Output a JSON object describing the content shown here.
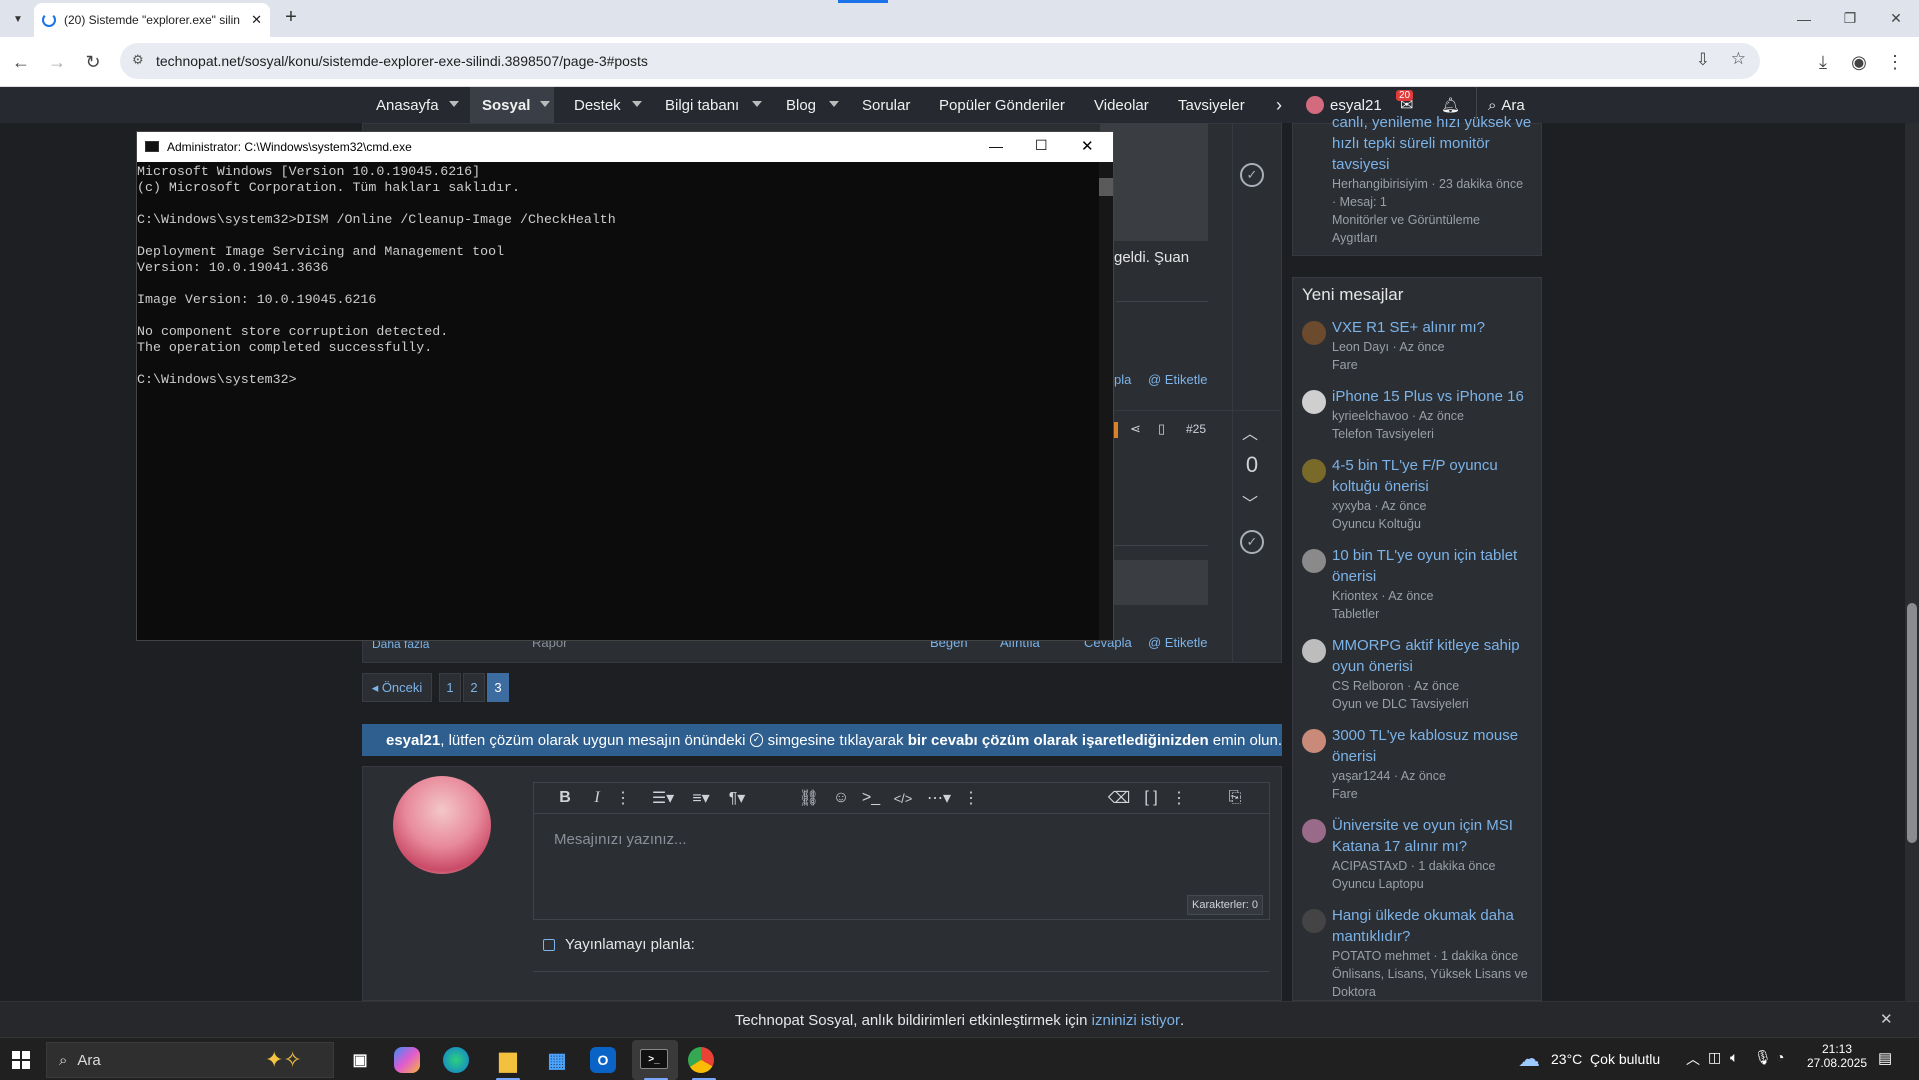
{
  "browser": {
    "tab_title": "(20) Sistemde \"explorer.exe\" silin",
    "url": "technopat.net/sosyal/konu/sistemde-explorer-exe-silindi.3898507/page-3#posts"
  },
  "site_nav": {
    "items": [
      "Anasayfa",
      "Sosyal",
      "Destek",
      "Bilgi tabanı",
      "Blog",
      "Sorular",
      "Popüler Gönderiler",
      "Videolar",
      "Tavsiyeler"
    ],
    "username": "esyal21",
    "inbox_badge": "20",
    "search_label": "Ara"
  },
  "sidebar": {
    "top_item": {
      "title_lines": [
        "canlı, yenileme hızı yüksek ve",
        "hızlı tepki süreli monitör",
        "tavsiyesi"
      ],
      "meta": "Herhangibirisiyim · 23 dakika önce",
      "meta2": "· Mesaj: 1",
      "category_lines": [
        "Monitörler ve Görüntüleme",
        "Aygıtları"
      ]
    },
    "heading": "Yeni mesajlar",
    "items": [
      {
        "title_lines": [
          "VXE R1 SE+ alınır mı?"
        ],
        "meta": "Leon Dayı · Az önce",
        "category_lines": [
          "Fare"
        ]
      },
      {
        "title_lines": [
          "iPhone 15 Plus vs iPhone 16"
        ],
        "meta": "kyrieelchavoo · Az önce",
        "category_lines": [
          "Telefon Tavsiyeleri"
        ]
      },
      {
        "title_lines": [
          "4-5 bin TL'ye F/P oyuncu",
          "koltuğu önerisi"
        ],
        "meta": "xyxyba · Az önce",
        "category_lines": [
          "Oyuncu Koltuğu"
        ]
      },
      {
        "title_lines": [
          "10 bin TL'ye oyun için tablet",
          "önerisi"
        ],
        "meta": "Kriontex · Az önce",
        "category_lines": [
          "Tabletler"
        ]
      },
      {
        "title_lines": [
          "MMORPG aktif kitleye sahip",
          "oyun önerisi"
        ],
        "meta": "CS Relboron · Az önce",
        "category_lines": [
          "Oyun ve DLC Tavsiyeleri"
        ]
      },
      {
        "title_lines": [
          "3000 TL'ye kablosuz mouse",
          "önerisi"
        ],
        "meta": "yaşar1244 · Az önce",
        "category_lines": [
          "Fare"
        ]
      },
      {
        "title_lines": [
          "Üniversite ve oyun için MSI",
          "Katana 17 alınır mı?"
        ],
        "meta": "ACIPASTAxD · 1 dakika önce",
        "category_lines": [
          "Oyuncu Laptopu"
        ]
      },
      {
        "title_lines": [
          "Hangi ülkede okumak daha",
          "mantıklıdır?"
        ],
        "meta": "POTATO mehmet · 1 dakika önce",
        "category_lines": [
          "Önlisans, Lisans, Yüksek Lisans ve",
          "Doktora"
        ]
      }
    ]
  },
  "post": {
    "partial_text": "geldi. Şuan",
    "reply_label": "pla",
    "tag_label": "@ Etiketle",
    "post_number": "#25",
    "vote_count": "0",
    "more_label": "Daha fazla",
    "report_label": "Rapor",
    "like_label": "Beğen",
    "quote_label": "Alıntıla",
    "reply_full": "Cevapla",
    "tag_label2": "@ Etiketle"
  },
  "pagination": {
    "prev": "◂ Önceki",
    "pages": [
      "1",
      "2",
      "3"
    ],
    "current": "3"
  },
  "notice": {
    "user": "esyal21",
    "text1": ", lütfen çözüm olarak uygun mesajın önündeki ",
    "text2": " simgesine tıklayarak ",
    "bold": "bir cevabı çözüm olarak işaretlediğinizden",
    "text3": " emin olun."
  },
  "editor": {
    "placeholder": "Mesajınızı yazınız...",
    "char_count": "Karakterler: 0",
    "schedule_label": "Yayınlamayı planla:"
  },
  "cmd": {
    "title": "Administrator: C:\\Windows\\system32\\cmd.exe",
    "lines": [
      "Microsoft Windows [Version 10.0.19045.6216]",
      "(c) Microsoft Corporation. Tüm hakları saklıdır.",
      "",
      "C:\\Windows\\system32>DISM /Online /Cleanup-Image /CheckHealth",
      "",
      "Deployment Image Servicing and Management tool",
      "Version: 10.0.19041.3636",
      "",
      "Image Version: 10.0.19045.6216",
      "",
      "No component store corruption detected.",
      "The operation completed successfully.",
      "",
      "C:\\Windows\\system32>"
    ]
  },
  "notification_bar": {
    "text": "Technopat Sosyal, anlık bildirimleri etkinleştirmek için ",
    "link": "izninizi istiyor",
    "end": "."
  },
  "taskbar": {
    "search_label": "Ara",
    "weather": "23°C  Çok bulutlu",
    "time": "21:13",
    "date": "27.08.2025"
  }
}
